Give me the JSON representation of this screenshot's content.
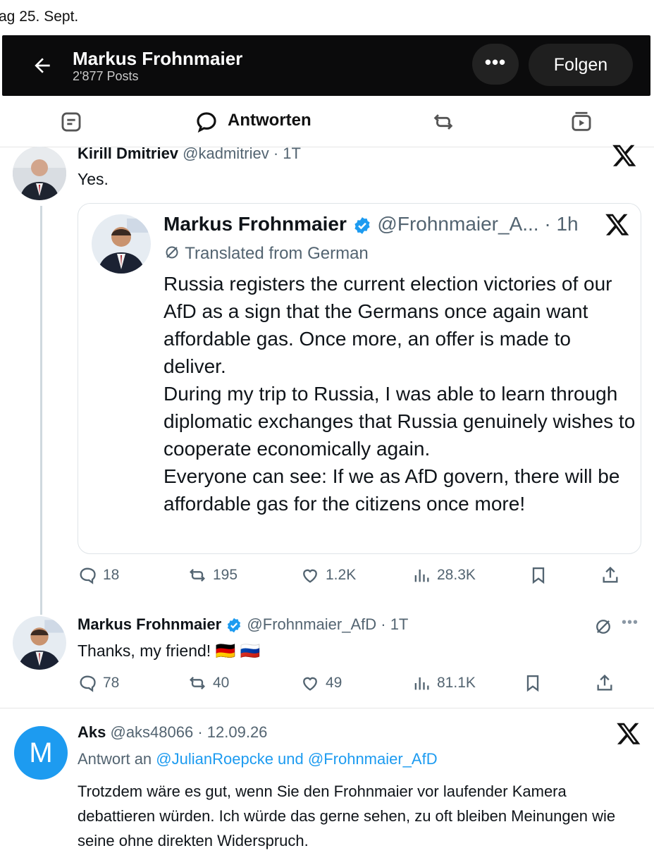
{
  "date_label": "ag 25. Sept.",
  "profile_header": {
    "name": "Markus Frohnmaier",
    "posts_count": "2'877 Posts",
    "follow_label": "Folgen",
    "more_label": "•••"
  },
  "tabs": {
    "active_label": "Antworten"
  },
  "reply1": {
    "author": "Kirill Dmitriev",
    "handle_time": "@kadmitriev · 1T",
    "text": "Yes.",
    "quote": {
      "author": "Markus Frohnmaier",
      "handle_time": "@Frohnmaier_A... · 1h",
      "translated": "Translated from German",
      "paragraphs": [
        "Russia registers the current election victories of our AfD as a sign that the Germans once again want affordable gas. Once more, an offer is made to deliver.",
        "During my trip to Russia, I was able to learn through diplomatic exchanges that Russia genuinely wishes to cooperate economically again.",
        "Everyone can see: If we as AfD govern, there will be affordable gas for the citizens once more!"
      ]
    },
    "stats": {
      "replies": "18",
      "reposts": "195",
      "likes": "1.2K",
      "views": "28.3K"
    }
  },
  "reply2": {
    "author": "Markus Frohnmaier",
    "handle_time": "@Frohnmaier_AfD · 1T",
    "text": "Thanks, my friend!",
    "flags": "🇩🇪 🇷🇺",
    "stats": {
      "replies": "78",
      "reposts": "40",
      "likes": "49",
      "views": "81.1K"
    }
  },
  "reply3": {
    "avatar_letter": "M",
    "author": "Aks",
    "handle_time": "@aks48066 · 12.09.26",
    "reply_to_prefix": "Antwort an",
    "reply_to_mentions": "@JulianRoepcke und @Frohnmaier_AfD",
    "text": "Trotzdem wäre es gut, wenn Sie den Frohnmaier vor laufender Kamera debattieren würden. Ich würde das gerne sehen, zu oft bleiben Meinungen wie seine ohne direkten Widerspruch."
  }
}
